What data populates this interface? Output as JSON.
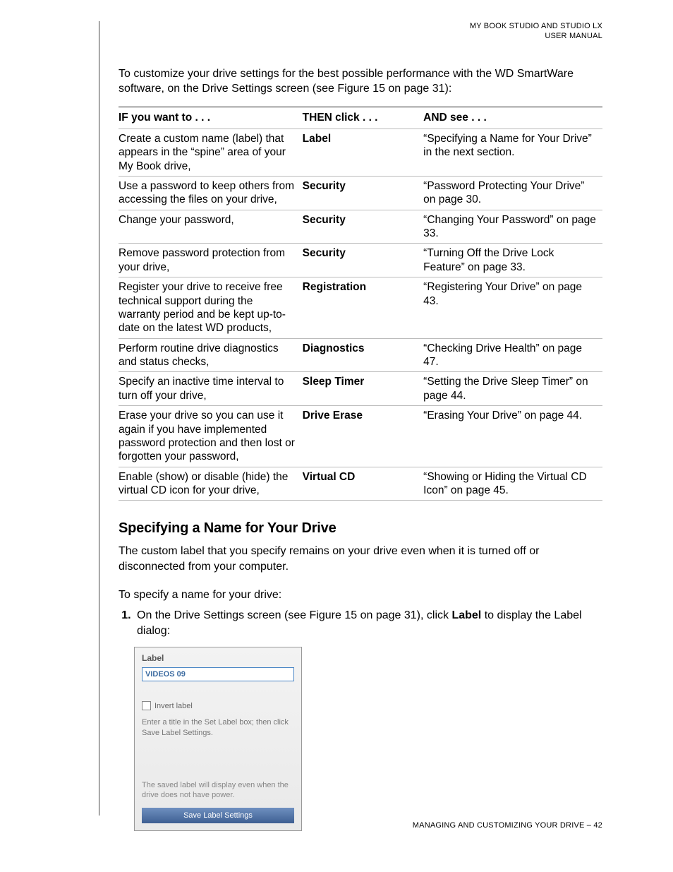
{
  "header": {
    "line1": "MY BOOK STUDIO AND  STUDIO LX",
    "line2": "USER MANUAL"
  },
  "intro": "To customize your drive settings for the best possible performance with the WD SmartWare software, on the Drive Settings screen (see Figure 15 on page 31):",
  "table": {
    "headers": {
      "if": "IF you want to . . .",
      "click": "THEN click . . .",
      "see": "AND see . . ."
    },
    "rows": [
      {
        "if": "Create a custom name (label) that appears in the “spine” area of your My Book drive,",
        "click": "Label",
        "see": "“Specifying a Name for Your Drive” in the next section."
      },
      {
        "if": "Use a password to keep others from accessing the files on your drive,",
        "click": "Security",
        "see": "“Password Protecting Your Drive” on page 30."
      },
      {
        "if": "Change your password,",
        "click": "Security",
        "see": "“Changing Your Password” on page 33."
      },
      {
        "if": "Remove password protection from your drive,",
        "click": "Security",
        "see": "“Turning Off the Drive Lock Feature” on page 33."
      },
      {
        "if": "Register your drive to receive free technical support during the warranty period and be kept up-to-date on the latest WD products,",
        "click": "Registration",
        "see": "“Registering Your Drive” on page 43."
      },
      {
        "if": "Perform routine drive diagnostics and status checks,",
        "click": "Diagnostics",
        "see": "“Checking Drive Health” on page 47."
      },
      {
        "if": "Specify an inactive time interval to turn off your drive,",
        "click": "Sleep Timer",
        "see": "“Setting the Drive Sleep Timer” on page 44."
      },
      {
        "if": "Erase your drive so you can use it again if you have implemented password protection and then lost or forgotten your password,",
        "click": "Drive Erase",
        "see": "“Erasing Your Drive” on page 44."
      },
      {
        "if": "Enable (show) or disable (hide) the virtual CD icon for your drive,",
        "click": "Virtual CD",
        "see": "“Showing or Hiding the Virtual CD Icon” on page 45."
      }
    ]
  },
  "section_heading": "Specifying a Name for Your Drive",
  "section_para": "The custom label that you specify remains on your drive even when it is turned off or disconnected from your computer.",
  "section_lead": "To specify a name for your drive:",
  "step1": {
    "pre": "On the Drive Settings screen (see Figure 15 on page 31), click ",
    "bold": "Label",
    "post": " to display the Label dialog:"
  },
  "dialog": {
    "title": "Label",
    "input_value": "VIDEOS 09",
    "checkbox": "Invert label",
    "hint": "Enter a title in the Set Label box; then click Save Label Settings.",
    "note": "The saved label will display even when the drive does not have power.",
    "button": "Save Label Settings"
  },
  "footer": "MANAGING AND CUSTOMIZING YOUR DRIVE – 42"
}
